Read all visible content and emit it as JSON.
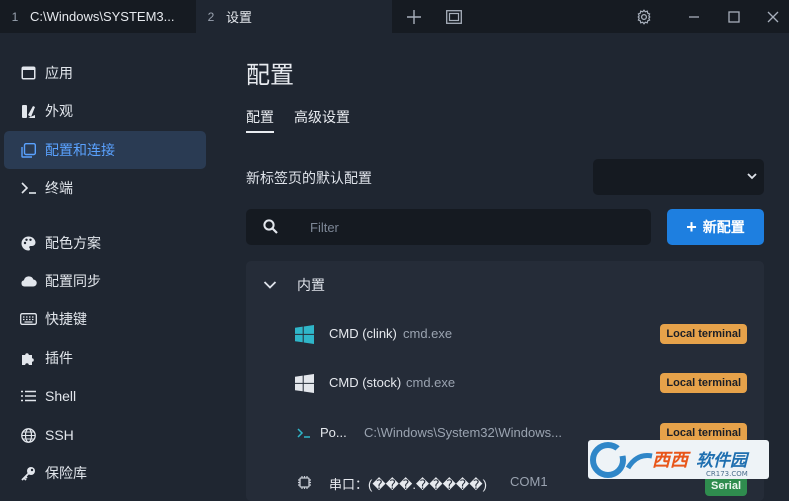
{
  "colors": {
    "accent": "#1e7fe0",
    "active_nav_text": "#5aa2ff",
    "badge_local": "#e6a24a",
    "badge_serial": "#2f8c4e",
    "icon_teal": "#2fb6c9"
  },
  "titlebar": {
    "tabs": [
      {
        "number": "1",
        "title": "C:\\Windows\\SYSTEM3..."
      },
      {
        "number": "2",
        "title": "设置"
      }
    ],
    "icons": [
      "plus-icon",
      "split-window-icon",
      "gear-icon",
      "minimize-icon",
      "maximize-icon",
      "close-icon"
    ]
  },
  "sidebar": {
    "items": [
      {
        "label": "应用",
        "icon": "app-window-icon",
        "active": false
      },
      {
        "label": "外观",
        "icon": "brush-icon",
        "active": false
      },
      {
        "label": "配置和连接",
        "icon": "profiles-icon",
        "active": true
      },
      {
        "label": "终端",
        "icon": "terminal-icon",
        "active": false
      },
      {
        "label": "配色方案",
        "icon": "palette-icon",
        "active": false
      },
      {
        "label": "配置同步",
        "icon": "cloud-icon",
        "active": false
      },
      {
        "label": "快捷键",
        "icon": "keyboard-icon",
        "active": false
      },
      {
        "label": "插件",
        "icon": "puzzle-icon",
        "active": false
      },
      {
        "label": "Shell",
        "icon": "list-icon",
        "active": false
      },
      {
        "label": "SSH",
        "icon": "globe-icon",
        "active": false
      },
      {
        "label": "保险库",
        "icon": "key-icon",
        "active": false
      }
    ]
  },
  "main": {
    "title": "配置",
    "tabs": [
      {
        "label": "配置"
      },
      {
        "label": "高级设置"
      }
    ],
    "default_profile_label": "新标签页的默认配置",
    "default_profile_value": "",
    "filter_placeholder": "Filter",
    "new_button_label": "新配置",
    "group_label": "内置",
    "profiles": [
      {
        "name": "CMD (clink)",
        "command": "cmd.exe",
        "badge": "Local terminal",
        "icon": "windows-logo-icon-teal"
      },
      {
        "name": "CMD (stock)",
        "command": "cmd.exe",
        "badge": "Local terminal",
        "icon": "windows-logo-icon"
      },
      {
        "name": "Po...",
        "command": "C:\\Windows\\System32\\Windows...",
        "badge": "Local terminal",
        "icon": "powershell-icon"
      },
      {
        "name": "串口：(���.�����)",
        "command": "COM1",
        "badge": "Serial",
        "icon": "chip-icon"
      }
    ]
  },
  "watermark": {
    "text": "西西软件园",
    "domain": "CR173.COM"
  }
}
